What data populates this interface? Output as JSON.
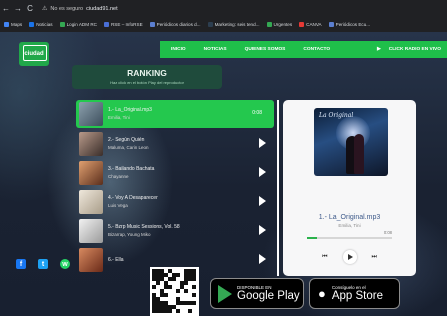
{
  "browser": {
    "nav": {
      "back": "←",
      "forward": "→",
      "reload": "C"
    },
    "security_label": "No es seguro",
    "url": "ciudad91.net",
    "bookmarks": [
      {
        "label": "Maps",
        "color": "#4285f4"
      },
      {
        "label": "Noticias",
        "color": "#1a73e8"
      },
      {
        "label": "Login ADM RC",
        "color": "#34a853"
      },
      {
        "label": "RSE – InfoRSE",
        "color": "#4a6fd6"
      },
      {
        "label": "Periódicos diarios d...",
        "color": "#5b7fd0"
      },
      {
        "label": "Marketing: seis tend...",
        "color": "#2c3e50"
      },
      {
        "label": "Urgentes",
        "color": "#34a853"
      },
      {
        "label": "CANVA",
        "color": "#e53935"
      },
      {
        "label": "Periódicos Ecu...",
        "color": "#5b7fd0"
      }
    ]
  },
  "site": {
    "logo_text": "ciudad",
    "nav": [
      "INICIO",
      "NOTICIAS",
      "QUIENES SOMOS",
      "CONTACTO"
    ],
    "radio_label": "CLICK RADIO EN VIVO",
    "ranking": {
      "title": "RANKING",
      "subtitle": "Haz click en el botón Play del reproductor"
    },
    "tracks": [
      {
        "title": "1.- La_Original.mp3",
        "artist": "Emilia, Tini",
        "duration": "0:08",
        "active": true,
        "color": "#5a6f7c"
      },
      {
        "title": "2.- Según Quién",
        "artist": "Maluma, Carin Leon",
        "color": "#6b5a52"
      },
      {
        "title": "3.- Bailando Bachata",
        "artist": "Chayanne",
        "color": "#8a5a3c"
      },
      {
        "title": "4.- Voy A Desaparecer",
        "artist": "Luis Vega",
        "color": "#cfc7b8"
      },
      {
        "title": "5.- Bzrp Music Sessions, Vol. 58",
        "artist": "Bizarrap, Young Miko",
        "color": "#dcdcdc"
      },
      {
        "title": "6.- Ella",
        "artist": "",
        "color": "#b86a4a"
      }
    ],
    "player": {
      "cover_text": "La Original",
      "title": "1.- La_Original.mp3",
      "artist": "Emilia, Tini",
      "time": "0:08",
      "progress": 0.12
    },
    "social": [
      {
        "icon": "facebook-icon",
        "glyph": "f",
        "color": "#1877f2"
      },
      {
        "icon": "twitter-icon",
        "glyph": "t",
        "color": "#1da1f2"
      },
      {
        "icon": "whatsapp-icon",
        "glyph": "w",
        "color": "#25d366"
      }
    ],
    "google_play": {
      "small": "DISPONIBLE EN",
      "big": "Google Play"
    },
    "app_store": {
      "small": "Consíguelo en el",
      "big": "App Store"
    }
  }
}
